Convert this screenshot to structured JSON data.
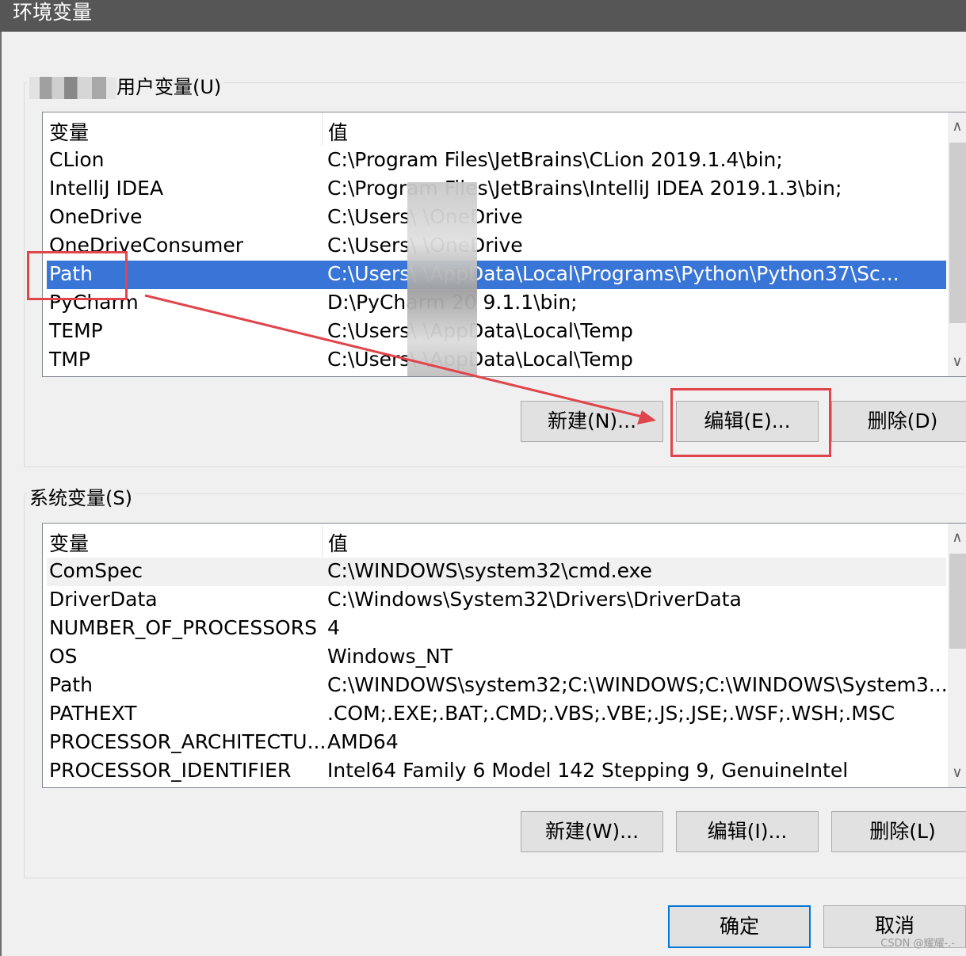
{
  "window": {
    "title": "环境变量"
  },
  "user_vars": {
    "group_label": "用户变量(U)",
    "columns": [
      "变量",
      "值"
    ],
    "rows": [
      {
        "name": "CLion",
        "value": "C:\\Program Files\\JetBrains\\CLion 2019.1.4\\bin;"
      },
      {
        "name": "IntelliJ IDEA",
        "value": "C:\\Program Files\\JetBrains\\IntelliJ IDEA 2019.1.3\\bin;"
      },
      {
        "name": "OneDrive",
        "value": "C:\\Users\\        \\OneDrive"
      },
      {
        "name": "OneDriveConsumer",
        "value": "C:\\Users\\        \\OneDrive"
      },
      {
        "name": "Path",
        "value": "C:\\Users\\        \\AppData\\Local\\Programs\\Python\\Python37\\Sc..."
      },
      {
        "name": "PyCharm",
        "value": "D:\\PyCharm 20  9.1.1\\bin;"
      },
      {
        "name": "TEMP",
        "value": "C:\\Users\\        \\AppData\\Local\\Temp"
      },
      {
        "name": "TMP",
        "value": "C:\\Users\\        \\AppData\\Local\\Temp"
      }
    ],
    "selected_index": 4,
    "buttons": {
      "new": "新建(N)...",
      "edit": "编辑(E)...",
      "delete": "删除(D)"
    }
  },
  "system_vars": {
    "group_label": "系统变量(S)",
    "columns": [
      "变量",
      "值"
    ],
    "rows": [
      {
        "name": "ComSpec",
        "value": "C:\\WINDOWS\\system32\\cmd.exe"
      },
      {
        "name": "DriverData",
        "value": "C:\\Windows\\System32\\Drivers\\DriverData"
      },
      {
        "name": "NUMBER_OF_PROCESSORS",
        "value": "4"
      },
      {
        "name": "OS",
        "value": "Windows_NT"
      },
      {
        "name": "Path",
        "value": "C:\\WINDOWS\\system32;C:\\WINDOWS;C:\\WINDOWS\\System3..."
      },
      {
        "name": "PATHEXT",
        "value": ".COM;.EXE;.BAT;.CMD;.VBS;.VBE;.JS;.JSE;.WSF;.WSH;.MSC"
      },
      {
        "name": "PROCESSOR_ARCHITECTU...",
        "value": "AMD64"
      },
      {
        "name": "PROCESSOR_IDENTIFIER",
        "value": "Intel64 Family 6 Model 142 Stepping 9, GenuineIntel"
      }
    ],
    "buttons": {
      "new": "新建(W)...",
      "edit": "编辑(I)...",
      "delete": "删除(L)"
    }
  },
  "footer": {
    "ok": "确定",
    "cancel": "取消"
  },
  "watermark": "CSDN @耀耀-.-",
  "colors": {
    "selection": "#3875d6",
    "annotation": "#e0454b",
    "accent": "#0078d7"
  },
  "icons": {
    "scroll_up": "chevron-up-icon",
    "scroll_down": "chevron-down-icon"
  }
}
